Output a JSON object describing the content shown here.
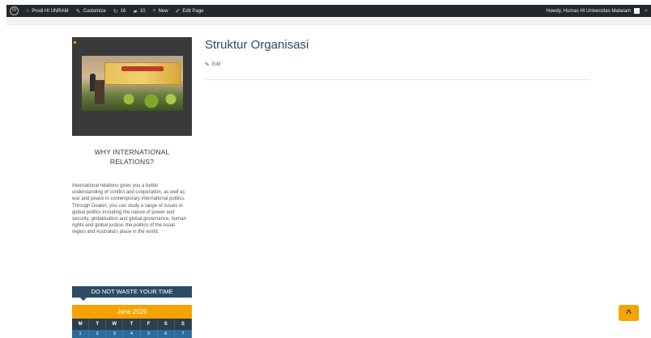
{
  "admin_bar": {
    "wp_logo_icon": "wordpress-logo-icon",
    "site_name": "Prodi HI UNRAM",
    "customize": "Customize",
    "updates_count": "16",
    "comments_count": "10",
    "new_label": "New",
    "edit_page": "Edit Page",
    "greeting": "Howdy, Humas HI Universitas Mataram"
  },
  "sidebar": {
    "widget_title": "WHY INTERNATIONAL RELATIONS?",
    "widget_text": "International relations gives you a better understanding of conflict and cooperation, as well as war and peace in contemporary international politics. Through Deakin, you can study a range of issues in global politics including the nature of power and security, globalisation and global governance, human rights and global justice, the politics of the Asian region and Australia's place in the world.",
    "banner_heading": "DO NOT WASTE YOUR TIME",
    "calendar": {
      "caption": "June 2020",
      "days": [
        "M",
        "T",
        "W",
        "T",
        "F",
        "S",
        "S"
      ],
      "first_row": [
        "1",
        "2",
        "3",
        "4",
        "5",
        "6",
        "7"
      ]
    }
  },
  "main": {
    "page_title": "Struktur Organisasi",
    "edit_label": "Edit"
  },
  "colors": {
    "admin_bar_bg": "#23282d",
    "accent": "#f5a300",
    "navy": "#2c4c66",
    "title_blue": "#2b4a63"
  }
}
